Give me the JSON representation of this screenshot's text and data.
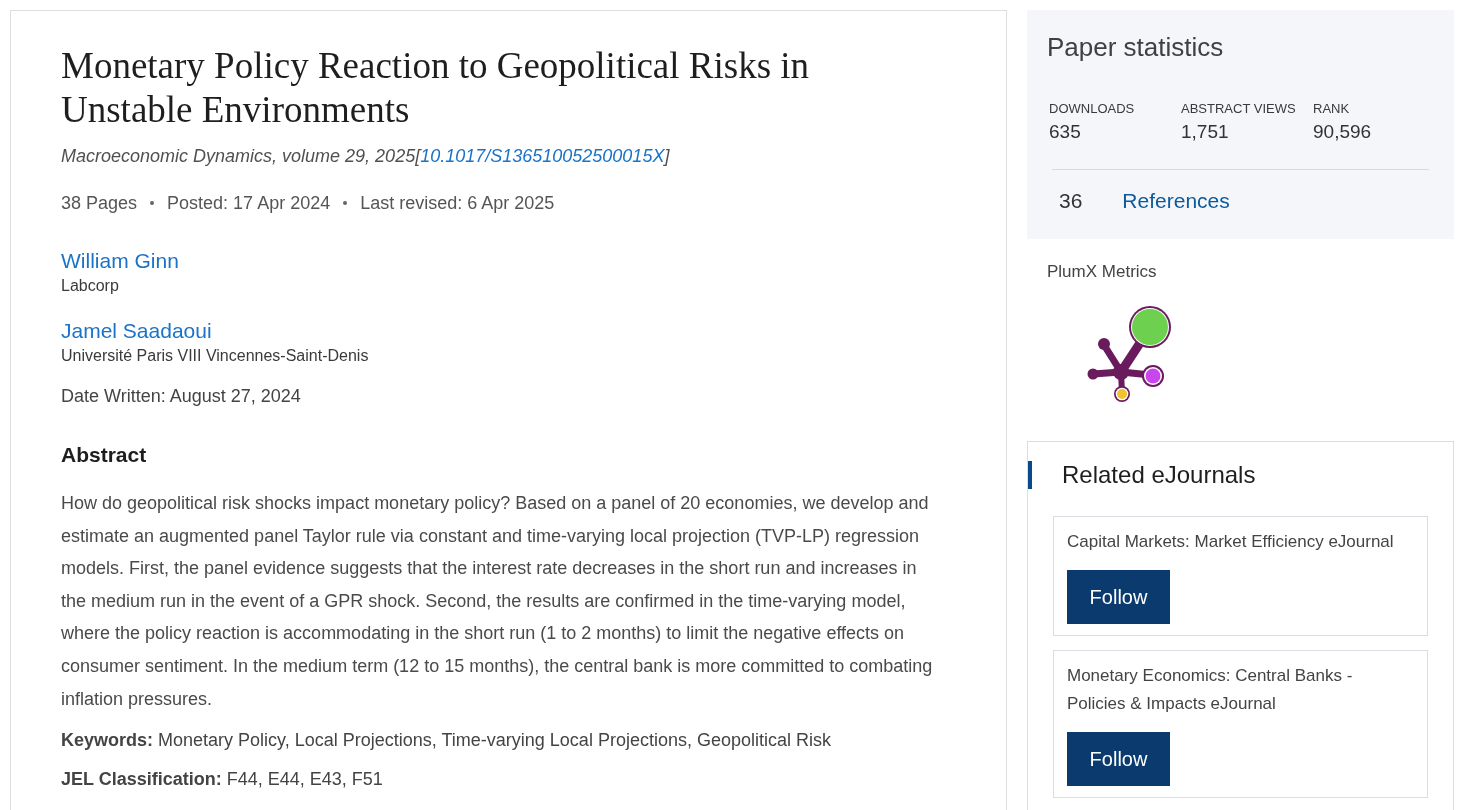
{
  "paper": {
    "title": "Monetary Policy Reaction to Geopolitical Risks in Unstable Environments",
    "journal_line": [
      {
        "kind": "text",
        "text": "Macroeconomic Dynamics, volume 29, 2025["
      },
      {
        "kind": "link",
        "text": "10.1017/S136510052500015X"
      },
      {
        "kind": "text",
        "text": "]"
      }
    ],
    "meta": [
      "38 Pages",
      "Posted: 17 Apr 2024",
      "Last revised: 6 Apr 2025"
    ],
    "authors": [
      {
        "name": "William Ginn",
        "affiliation": "Labcorp"
      },
      {
        "name": "Jamel Saadaoui",
        "affiliation": "Université Paris VIII Vincennes-Saint-Denis"
      }
    ],
    "date_written": "Date Written: August 27, 2024",
    "abstract": {
      "heading": "Abstract",
      "text": "How do geopolitical risk shocks impact monetary policy? Based on a panel of 20 economies, we develop and estimate an augmented panel Taylor rule via constant and time-varying local projection (TVP-LP) regression models. First, the panel evidence suggests that the interest rate decreases in the short run and increases in the medium run in the event of a GPR shock. Second, the results are confirmed in the time-varying model, where the policy reaction is accommodating in the short run (1 to 2 months) to limit the negative effects on consumer sentiment. In the medium term (12 to 15 months), the central bank is more committed to combating inflation pressures."
    },
    "keywords": "**Keywords:** Monetary Policy, Local Projections, Time-varying Local Projections, Geopolitical Risk",
    "jel_classification": "**JEL Classification:** F44, E44, E43, F51"
  },
  "paper_statistics": {
    "title": "Paper statistics",
    "stats": [
      {
        "label": "DOWNLOADS",
        "value": "635"
      },
      {
        "label": "ABSTRACT VIEWS",
        "value": "1,751"
      },
      {
        "label": "RANK",
        "value": "90,596"
      }
    ],
    "references": {
      "count": "36",
      "label": "References"
    }
  },
  "plumx": {
    "title": "PlumX Metrics"
  },
  "related_ejournals": {
    "title": "Related eJournals",
    "journals": [
      {
        "name": "Capital Markets: Market Efficiency eJournal",
        "button": "Follow"
      },
      {
        "name": "Monetary Economics: Central Banks - Policies & Impacts eJournal",
        "button": "Follow"
      }
    ]
  }
}
